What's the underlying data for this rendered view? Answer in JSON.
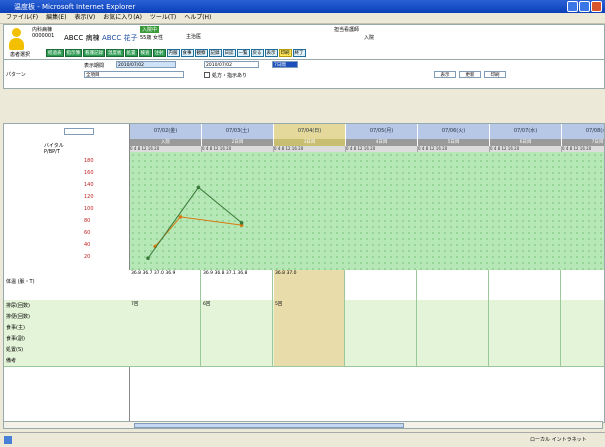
{
  "window": {
    "title": "温度板 - Microsoft Internet Explorer"
  },
  "menu": [
    "ファイル(F)",
    "編集(E)",
    "表示(V)",
    "お気に入り(A)",
    "ツール(T)",
    "ヘルプ(H)"
  ],
  "header": {
    "patient_id": "0000001",
    "ward": "内科病棟",
    "room": "ABCC 病棟",
    "badge": "入院中",
    "name": "ABCC 花子",
    "age_sex": "55歳 女性",
    "dr_label": "主治医",
    "status": "入院",
    "notice": "担当看護師",
    "nav_label": "患者選択",
    "toolbar": [
      "経過表",
      "指示簿",
      "看護記録",
      "温度板",
      "処置",
      "検査",
      "注射",
      "内服",
      "食事",
      "観察",
      "記録",
      "日誌",
      "一覧",
      "戻る",
      "表示",
      "印刷",
      "終了"
    ]
  },
  "controls": {
    "period_label": "表示期間",
    "period_value": "2010/07/02",
    "date_value": "2010/07/02",
    "day_value": "7日間",
    "pattern_label": "パターン",
    "pattern_value": "全項目",
    "checkbox_label": "処方・指示あり",
    "view_label": "表示",
    "update_label": "更新",
    "print_label": "印刷"
  },
  "grid": {
    "dates": [
      "07/02(金)",
      "07/03(土)",
      "07/04(日)",
      "07/05(月)",
      "07/06(火)",
      "07/07(水)",
      "07/08(木)"
    ],
    "day_labels": [
      "入院",
      "2日目",
      "3日目",
      "4日目",
      "5日目",
      "6日目",
      "7日目"
    ],
    "tick_labels": "0 4 8 12 16 20",
    "selected_col": 2,
    "left_headers": [
      "バイタル",
      "P/BP/T"
    ],
    "scale_labels": [
      "180",
      "160",
      "140",
      "120",
      "100",
      "80",
      "60",
      "40",
      "20"
    ]
  },
  "rows": [
    {
      "label": "体温 (脈・T)",
      "cells": [
        "36.8 36.7 37.0 36.9",
        "36.9 36.8 37.1 36.8",
        "36.8 37.0",
        "",
        "",
        "",
        ""
      ]
    },
    {
      "label": "排尿(回数)",
      "cells": [
        "7回",
        "6回",
        "5回",
        "",
        "",
        "",
        ""
      ]
    },
    {
      "label": "排便(回数)",
      "cells": [
        "",
        "",
        "",
        "",
        "",
        "",
        ""
      ]
    },
    {
      "label": "食事(主)",
      "cells": [
        "",
        "",
        "",
        "",
        "",
        "",
        ""
      ]
    },
    {
      "label": "食事(副)",
      "cells": [
        "",
        "",
        "",
        "",
        "",
        "",
        ""
      ]
    },
    {
      "label": "処置(S)",
      "cells": [
        "",
        "",
        "",
        "",
        "",
        "",
        ""
      ]
    },
    {
      "label": "備考",
      "cells": [
        "",
        "",
        "",
        "",
        "",
        "",
        ""
      ]
    }
  ],
  "chart_data": {
    "type": "line",
    "series": [
      {
        "name": "",
        "color": "#d87a10",
        "values": [
          {
            "x": 0.35,
            "y": 0.8
          },
          {
            "x": 0.7,
            "y": 0.55
          },
          {
            "x": 1.55,
            "y": 0.62
          }
        ]
      },
      {
        "name": "",
        "color": "#3a7a3a",
        "values": [
          {
            "x": 0.25,
            "y": 0.9
          },
          {
            "x": 0.95,
            "y": 0.3
          },
          {
            "x": 1.55,
            "y": 0.6
          }
        ]
      }
    ]
  },
  "statusbar": {
    "zone": "ローカル イントラネット"
  }
}
